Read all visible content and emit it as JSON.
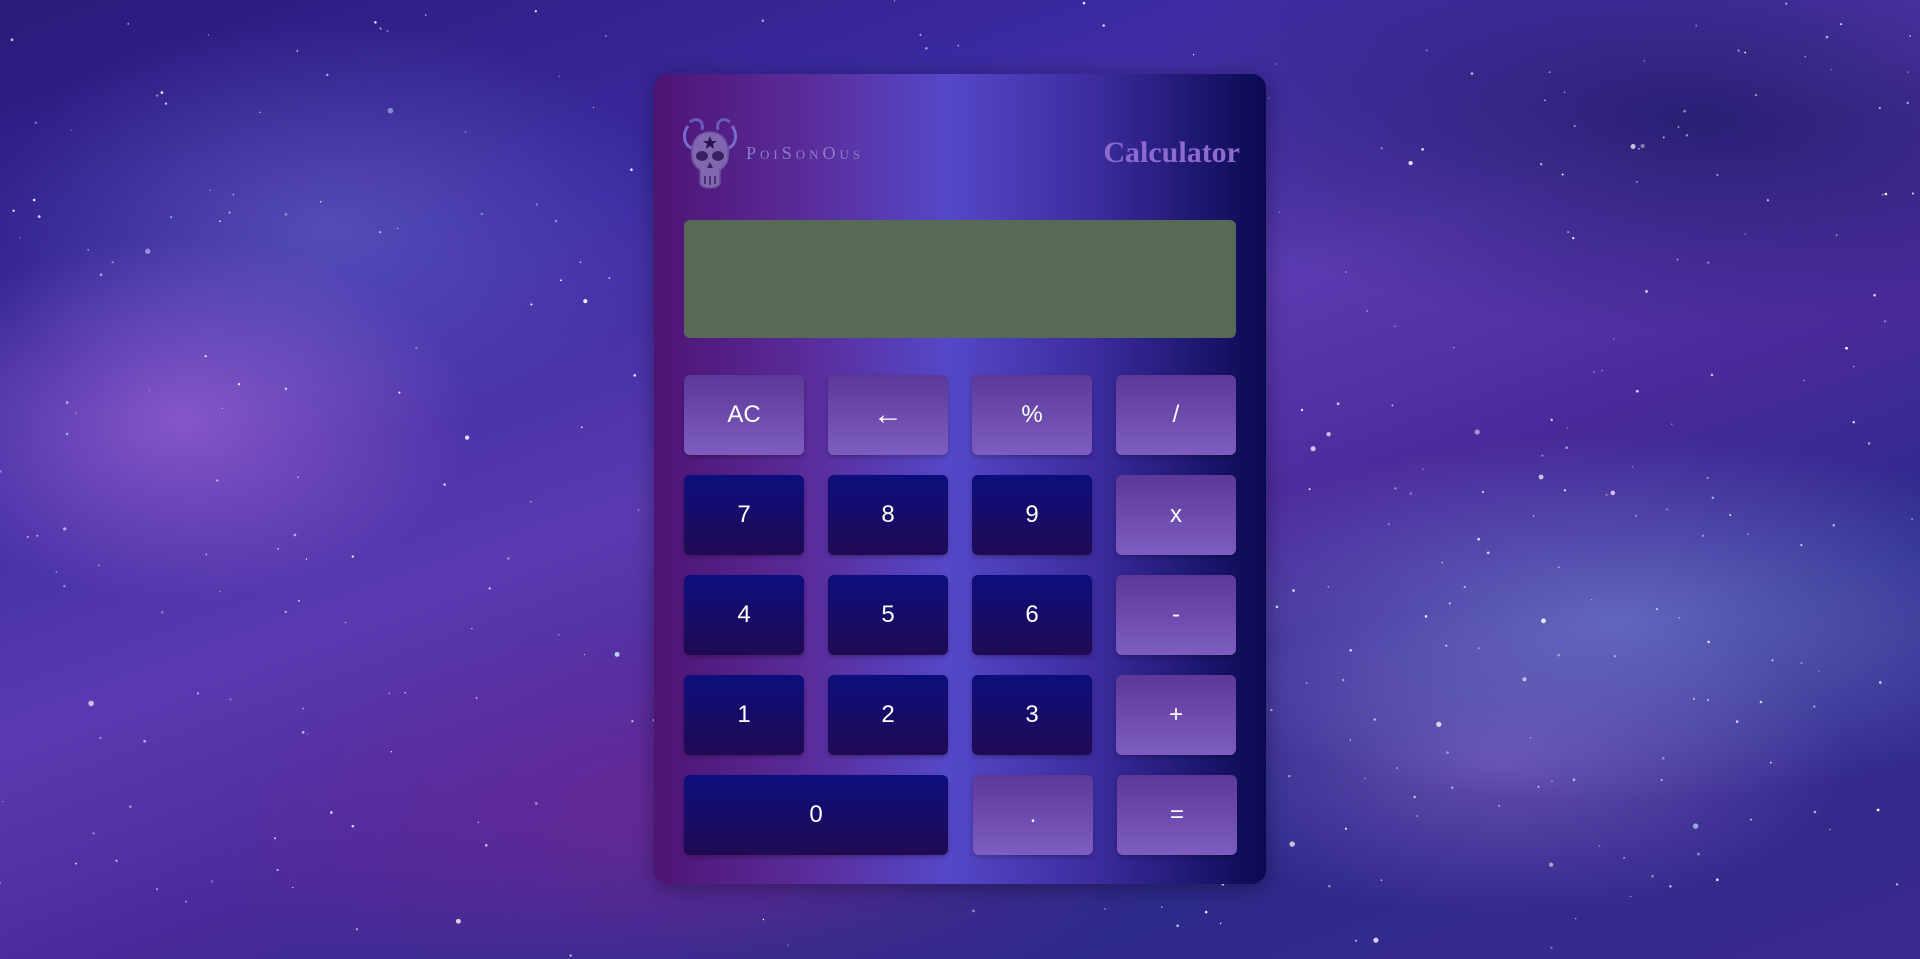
{
  "app": {
    "title": "Calculator",
    "logo_text": "PoiSonOus"
  },
  "display": {
    "value": ""
  },
  "buttons": {
    "ac": "AC",
    "backspace": "←",
    "percent": "%",
    "divide": "/",
    "seven": "7",
    "eight": "8",
    "nine": "9",
    "multiply": "x",
    "four": "4",
    "five": "5",
    "six": "6",
    "minus": "-",
    "one": "1",
    "two": "2",
    "three": "3",
    "plus": "+",
    "zero": "0",
    "decimal": ".",
    "equals": "="
  },
  "colors": {
    "display_bg": "#566a55",
    "operator_button": "#7d5ec0",
    "number_button": "#0c0e7e",
    "title": "#8d6ad0"
  },
  "icons": {
    "logo": "skull-with-snakes-icon"
  }
}
